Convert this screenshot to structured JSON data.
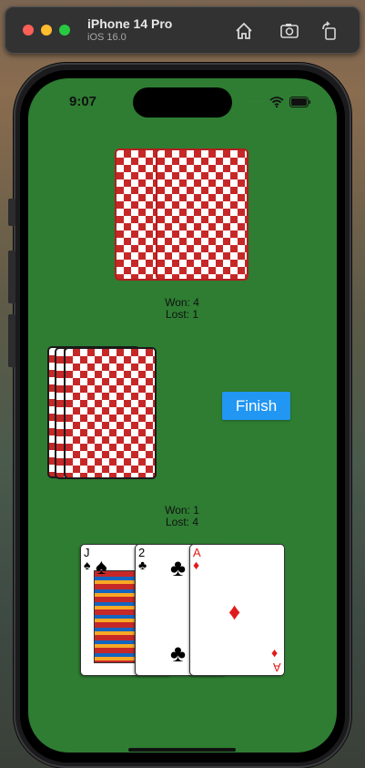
{
  "simulator": {
    "device_name": "iPhone 14 Pro",
    "os_version": "iOS 16.0",
    "toolbar_icons": [
      "home-icon",
      "screenshot-icon",
      "rotate-icon"
    ]
  },
  "status_bar": {
    "time": "9:07",
    "dots": "····"
  },
  "opponent_score": {
    "won": "Won: 4",
    "lost": "Lost: 1"
  },
  "player_score": {
    "won": "Won: 1",
    "lost": "Lost: 4"
  },
  "finish_button": {
    "label": "Finish"
  },
  "player_hand": [
    {
      "rank": "J",
      "suit": "♠",
      "color": "black"
    },
    {
      "rank": "2",
      "suit": "♣",
      "color": "black"
    },
    {
      "rank": "A",
      "suit": "♦",
      "color": "red"
    }
  ],
  "colors": {
    "table_green": "#2e7d32",
    "card_back_red": "#c62828",
    "button_blue": "#2196f3"
  }
}
